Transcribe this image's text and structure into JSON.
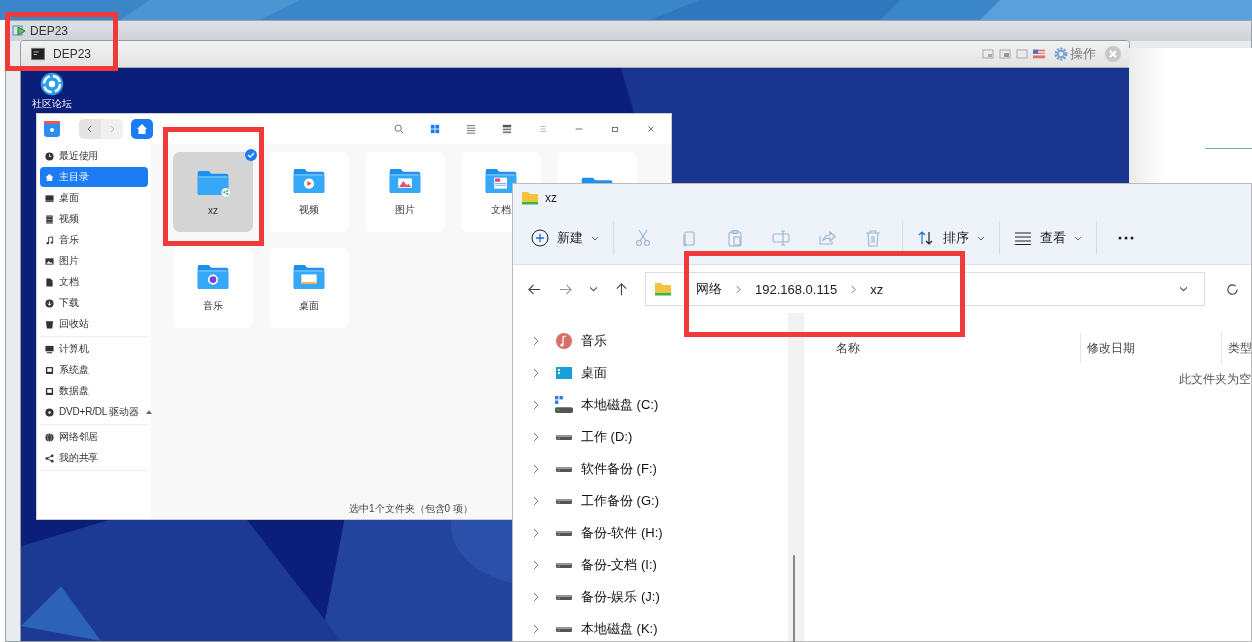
{
  "host_window": {
    "title": "DEP23",
    "highlighted": true
  },
  "vm_window": {
    "tab_title": "DEP23",
    "menu_label": "操作"
  },
  "desktop_icons": [
    {
      "label": "社区论坛"
    }
  ],
  "file_manager": {
    "sidebar_groups": [
      {
        "items": [
          {
            "label": "最近使用",
            "kind": "clock",
            "selected": false
          },
          {
            "label": "主目录",
            "kind": "home",
            "selected": true
          },
          {
            "label": "桌面",
            "kind": "desktop",
            "selected": false
          },
          {
            "label": "视频",
            "kind": "video",
            "selected": false
          },
          {
            "label": "音乐",
            "kind": "music",
            "selected": false
          },
          {
            "label": "图片",
            "kind": "picture",
            "selected": false
          },
          {
            "label": "文档",
            "kind": "document",
            "selected": false
          },
          {
            "label": "下载",
            "kind": "download",
            "selected": false
          },
          {
            "label": "回收站",
            "kind": "trash",
            "selected": false
          }
        ]
      },
      {
        "items": [
          {
            "label": "计算机",
            "kind": "computer",
            "selected": false
          },
          {
            "label": "系统盘",
            "kind": "disk",
            "selected": false
          },
          {
            "label": "数据盘",
            "kind": "disk",
            "selected": false
          },
          {
            "label": "DVD+R/DL 驱动器",
            "kind": "dvd",
            "selected": false,
            "ejectable": true
          }
        ]
      },
      {
        "items": [
          {
            "label": "网络邻居",
            "kind": "network",
            "selected": false
          },
          {
            "label": "我的共享",
            "kind": "share",
            "selected": false
          }
        ]
      }
    ],
    "items": [
      {
        "label": "xz",
        "kind": "shared",
        "selected": true,
        "highlighted": true
      },
      {
        "label": "视频",
        "kind": "video",
        "selected": false
      },
      {
        "label": "图片",
        "kind": "picture",
        "selected": false
      },
      {
        "label": "文档",
        "kind": "document",
        "selected": false
      },
      {
        "kind": "generic",
        "selected": false
      },
      {
        "label": "音乐",
        "kind": "music",
        "selected": false
      },
      {
        "label": "桌面",
        "kind": "desktop",
        "selected": false
      }
    ],
    "status": "选中1个文件夹（包含0 项）"
  },
  "explorer": {
    "title": "xz",
    "toolbar": [
      {
        "kind": "new",
        "label": "新建",
        "disabled": false
      },
      {
        "kind": "cut",
        "disabled": true
      },
      {
        "kind": "copy",
        "disabled": true
      },
      {
        "kind": "paste",
        "disabled": true
      },
      {
        "kind": "rename",
        "disabled": true
      },
      {
        "kind": "share",
        "disabled": true
      },
      {
        "kind": "delete",
        "disabled": true
      },
      {
        "kind": "sort",
        "label": "排序",
        "disabled": false
      },
      {
        "kind": "view",
        "label": "查看",
        "disabled": false
      },
      {
        "kind": "more",
        "disabled": false
      }
    ],
    "address": {
      "segments": [
        "网络",
        "192.168.0.115",
        "xz"
      ],
      "highlighted": true
    },
    "tree": [
      {
        "label": "音乐",
        "kind": "music"
      },
      {
        "label": "桌面",
        "kind": "desktop"
      },
      {
        "label": "本地磁盘 (C:)",
        "kind": "system-drive"
      },
      {
        "label": "工作 (D:)",
        "kind": "drive"
      },
      {
        "label": "软件备份 (F:)",
        "kind": "drive"
      },
      {
        "label": "工作备份 (G:)",
        "kind": "drive"
      },
      {
        "label": "备份-软件 (H:)",
        "kind": "drive"
      },
      {
        "label": "备份-文档 (I:)",
        "kind": "drive"
      },
      {
        "label": "备份-娱乐 (J:)",
        "kind": "drive"
      },
      {
        "label": "本地磁盘 (K:)",
        "kind": "drive"
      }
    ],
    "columns": [
      "名称",
      "修改日期",
      "类型"
    ],
    "empty_text": "此文件夹为空"
  }
}
